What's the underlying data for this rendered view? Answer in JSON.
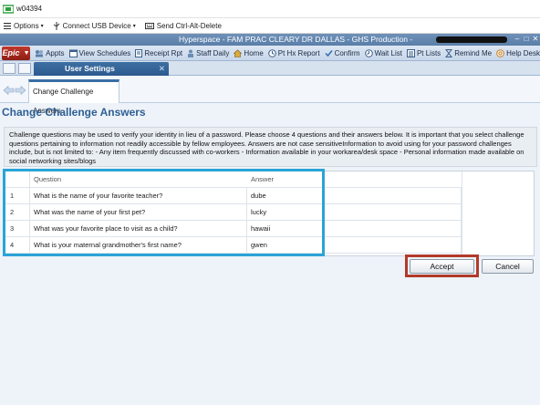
{
  "remote": {
    "title": "w04394",
    "toolbar": [
      {
        "label": "Options",
        "icon": "menu-icon"
      },
      {
        "label": "Connect USB Device",
        "icon": "usb-icon"
      },
      {
        "label": "Send Ctrl-Alt-Delete",
        "icon": "keyboard-icon"
      }
    ]
  },
  "hyperspace": {
    "title": "Hyperspace - FAM PRAC CLEARY DR DALLAS - GHS Production -"
  },
  "epic": {
    "brand": "Epic",
    "toolbar": [
      {
        "label": "Appts",
        "icon": "appointments-icon"
      },
      {
        "label": "View Schedules",
        "icon": "schedule-icon"
      },
      {
        "label": "Receipt Rpt",
        "icon": "receipt-icon"
      },
      {
        "label": "Staff Daily",
        "icon": "staff-icon"
      },
      {
        "label": "Home",
        "icon": "home-icon"
      },
      {
        "label": "Pt Hx Report",
        "icon": "history-icon"
      },
      {
        "label": "Confirm",
        "icon": "confirm-icon"
      },
      {
        "label": "Wait List",
        "icon": "waitlist-icon"
      },
      {
        "label": "Pt Lists",
        "icon": "patient-list-icon"
      },
      {
        "label": "Remind Me",
        "icon": "reminder-icon"
      },
      {
        "label": "Help Desk",
        "icon": "help-icon"
      }
    ]
  },
  "tabs": {
    "active": "User Settings",
    "close": "✕"
  },
  "nav": {
    "tab": "Change Challenge Answers"
  },
  "page": {
    "title": "Change Challenge Answers",
    "description": "Challenge questions may be used to verify your identity in lieu of a password. Please choose 4 questions and their answers below. It is important that you select challenge questions pertaining to information not readily accessible by fellow employees. Answers are not case sensitiveInformation to avoid using for your password challenges include, but is not limited to:  - Any item frequently discussed with co-workers - Information available in your workarea/desk space - Personal information made available on social networking sites/blogs"
  },
  "table": {
    "headers": {
      "question": "Question",
      "answer": "Answer"
    },
    "rows": [
      {
        "num": "1",
        "question": "What is the name of your favorite teacher?",
        "answer": "dube"
      },
      {
        "num": "2",
        "question": "What was the name of your first pet?",
        "answer": "lucky"
      },
      {
        "num": "3",
        "question": "What was your favorite place to visit as a child?",
        "answer": "hawaii"
      },
      {
        "num": "4",
        "question": "What is your maternal grandmother's first name?",
        "answer": "gwen"
      }
    ]
  },
  "buttons": {
    "accept": "Accept",
    "cancel": "Cancel"
  },
  "colors": {
    "highlight_blue": "#2aa4d8",
    "highlight_red": "#b23a2a",
    "title_blue": "#2e5f94",
    "epic_red": "#c0392b"
  }
}
